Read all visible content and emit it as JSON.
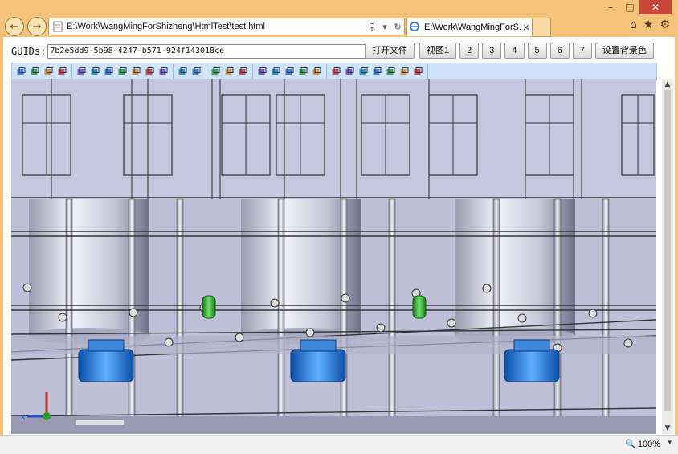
{
  "window": {
    "controls": {
      "minimize_icon": "–",
      "maximize_icon": "□",
      "close_icon": "✕"
    }
  },
  "browser": {
    "back_icon": "←",
    "forward_icon": "→",
    "address_url": "E:\\Work\\WangMingForShizheng\\HtmlTest\\test.html",
    "search_icon": "⚲",
    "dropdown_icon": "▾",
    "refresh_icon": "↻",
    "tab_title": "E:\\Work\\WangMingForS...",
    "tab_close": "✕",
    "home_icon": "⌂",
    "favorites_icon": "★",
    "settings_icon": "⚙"
  },
  "page": {
    "guid_label": "GUIDs:",
    "guid_value": "7b2e5dd9-5b98-4247-b571-924f143018ce",
    "buttons": [
      "打开文件",
      "视图1",
      "2",
      "3",
      "4",
      "5",
      "6",
      "7",
      "设置背景色"
    ]
  },
  "toolbar": {
    "groups": [
      [
        "open-folder-icon",
        "add-icon",
        "save-icon",
        "export-icon"
      ],
      [
        "rotate-icon",
        "cube-select-icon",
        "box-icon",
        "pointer-icon",
        "measure-icon",
        "section-icon",
        "plane-icon"
      ],
      [
        "fit-icon",
        "target-icon"
      ],
      [
        "xyz-axis-icon",
        "xyz-plane-icon",
        "xyz-reset-icon"
      ],
      [
        "wire-icon",
        "solid-icon",
        "hidden-icon",
        "shade-icon",
        "edge-icon"
      ],
      [
        "view-front-icon",
        "view-top-icon",
        "view-side-icon",
        "view-iso-icon",
        "view-back-icon",
        "view-bottom-icon",
        "reset-view-icon"
      ]
    ]
  },
  "status": {
    "zoom_icon": "🔍",
    "zoom_level": "100%",
    "zoom_caret": "▾"
  },
  "colors": {
    "frame": "#f4c27a",
    "toolbar": "#cfe3fb",
    "viewport_bg": "#c2c2dc",
    "pipe_green": "#2a9a2a",
    "pump_blue": "#1f6fcf"
  }
}
